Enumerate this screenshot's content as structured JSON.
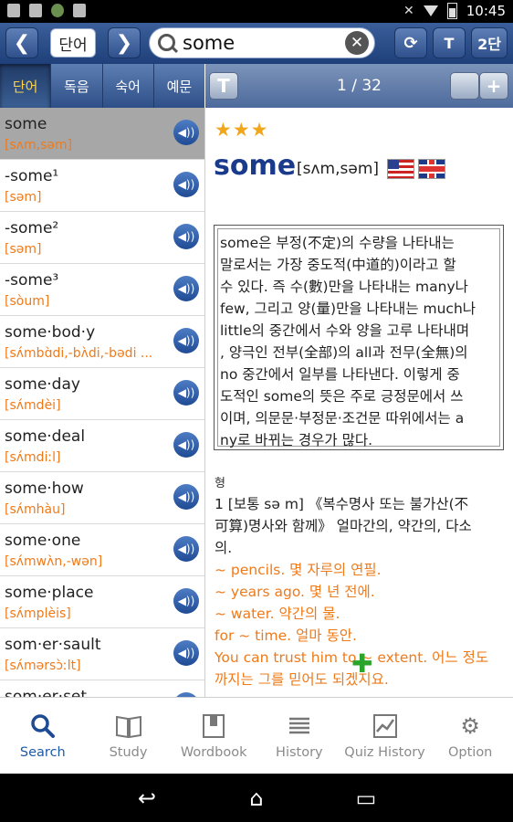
{
  "status": {
    "time": "10:45"
  },
  "toolbar": {
    "word_button": "단어",
    "search_value": "some",
    "twocol_label": "2단"
  },
  "tabs": [
    "단어",
    "독음",
    "숙어",
    "예문"
  ],
  "detail_header": {
    "t_label": "T",
    "page": "1 / 32"
  },
  "list": [
    {
      "word": "some",
      "pron": "[sʌm,səm]"
    },
    {
      "word": "-some¹",
      "pron": "[səm]"
    },
    {
      "word": "-some²",
      "pron": "[səm]"
    },
    {
      "word": "-some³",
      "pron": "[sòum]"
    },
    {
      "word": "some·bod·y",
      "pron": "[sʌ́mbɑ̀di,-bʌ̀di,-bədi ..."
    },
    {
      "word": "some·day",
      "pron": "[sʌ́mdèi]"
    },
    {
      "word": "some·deal",
      "pron": "[sʌ́mdiːl]"
    },
    {
      "word": "some·how",
      "pron": "[sʌ́mhàu]"
    },
    {
      "word": "some·one",
      "pron": "[sʌ́mwʌ̀n,-wən]"
    },
    {
      "word": "some·place",
      "pron": "[sʌ́mplèis]"
    },
    {
      "word": "som·er·sault",
      "pron": "[sʌ́mərsɔ̀ːlt]"
    },
    {
      "word": "som·er·set",
      "pron": ""
    }
  ],
  "entry": {
    "stars": "★★★",
    "headword": "some",
    "pron": "[sʌm,səm]",
    "note_lines": [
      "some은 부정(不定)의 수량을 나타내는",
      "말로서는 가장 중도적(中道的)이라고 할",
      "수 있다. 즉 수(數)만을 나타내는 many나",
      "few, 그리고 양(量)만을 나타내는 much나",
      "little의 중간에서 수와 양을 고루 나타내며",
      ", 양극인 전부(全部)의 all과 전무(全無)의",
      "no 중간에서 일부를 나타낸다. 이렇게 중",
      "도적인 some의 뜻은 주로 긍정문에서 쓰",
      "이며, 의문문·부정문·조건문 따위에서는 a",
      "ny로 바뀌는 경우가 많다."
    ],
    "pos": "형",
    "def_lines": [
      "1 [보통 sə m] 《복수명사 또는 불가산(不",
      "可算)명사와 함께》 얼마간의, 약간의, 다소",
      "의."
    ],
    "examples": [
      "~ pencils. 몇 자루의 연필.",
      "~ years ago. 몇 년 전에.",
      "~ water. 약간의 물.",
      "for ~ time. 얼마 동안.",
      "You can trust him to ~ extent. 어느 정도",
      "까지는 그를 믿어도 되겠지요."
    ]
  },
  "bottom_nav": [
    {
      "label": "Search",
      "icon": "search-icon"
    },
    {
      "label": "Study",
      "icon": "book-icon"
    },
    {
      "label": "Wordbook",
      "icon": "wordbook-icon"
    },
    {
      "label": "History",
      "icon": "history-icon"
    },
    {
      "label": "Quiz History",
      "icon": "quiz-history-icon"
    },
    {
      "label": "Option",
      "icon": "gear-icon"
    }
  ],
  "colors": {
    "accent": "#1f4b95",
    "highlight": "#ef7a1a",
    "star": "#f2a61a"
  }
}
